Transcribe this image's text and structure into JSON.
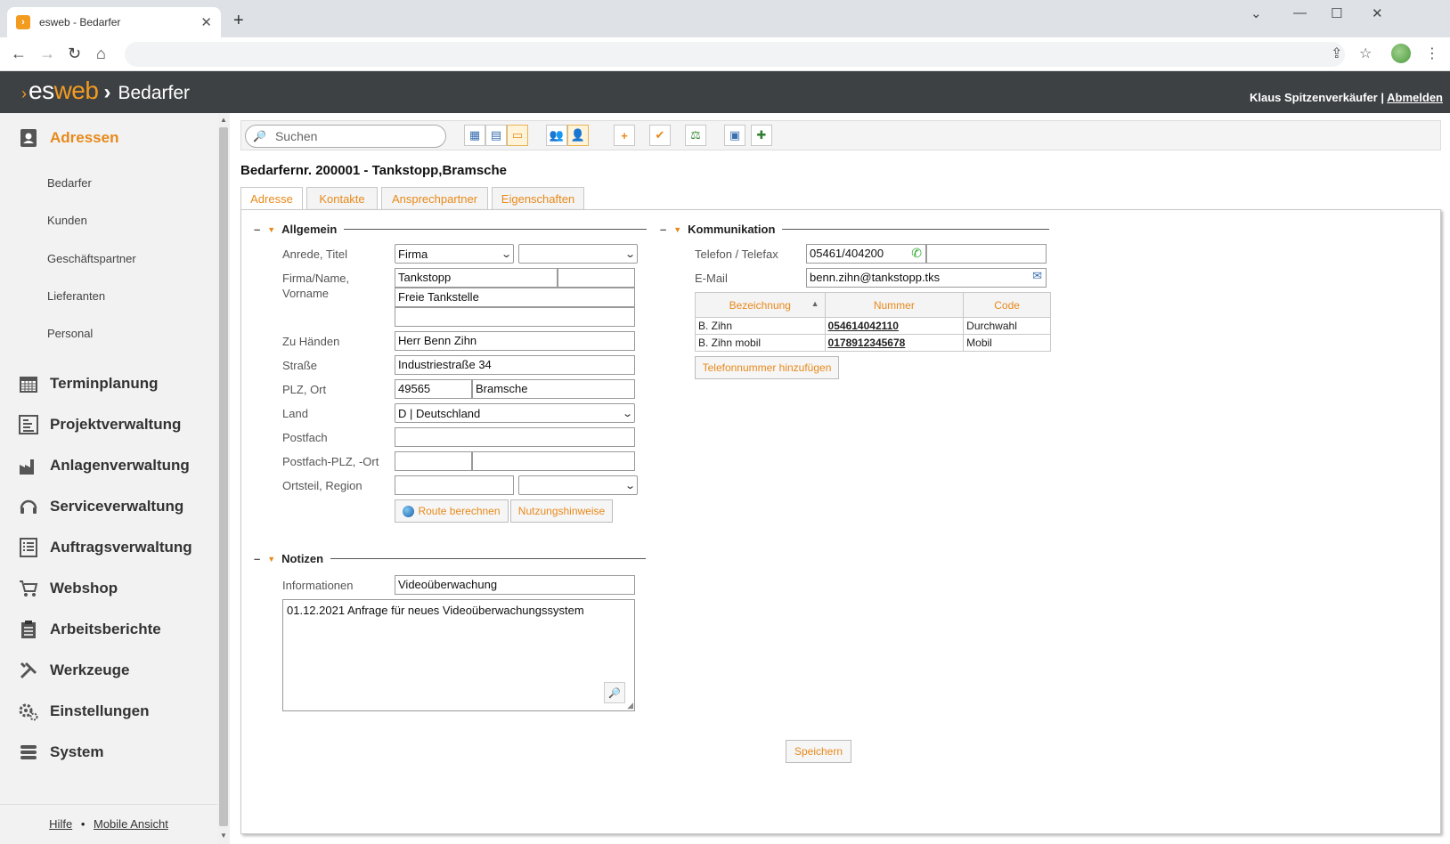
{
  "browser": {
    "tab_title": "esweb - Bedarfer",
    "tab_close": "✕",
    "new_tab": "+"
  },
  "app": {
    "logo_es": "es",
    "logo_web": "web",
    "app_name": "Bedarfer",
    "user_name": "Klaus Spitzenverkäufer",
    "separator": "|",
    "logout": "Abmelden"
  },
  "sidebar": {
    "main_items": [
      {
        "label": "Adressen",
        "icon": "address-book-icon"
      },
      {
        "label": "Terminplanung",
        "icon": "calendar-icon"
      },
      {
        "label": "Projektverwaltung",
        "icon": "project-icon"
      },
      {
        "label": "Anlagenverwaltung",
        "icon": "factory-icon"
      },
      {
        "label": "Serviceverwaltung",
        "icon": "headset-icon"
      },
      {
        "label": "Auftragsverwaltung",
        "icon": "list-icon"
      },
      {
        "label": "Webshop",
        "icon": "cart-icon"
      },
      {
        "label": "Arbeitsberichte",
        "icon": "clipboard-icon"
      },
      {
        "label": "Werkzeuge",
        "icon": "tools-icon"
      },
      {
        "label": "Einstellungen",
        "icon": "gears-icon"
      },
      {
        "label": "System",
        "icon": "database-icon"
      }
    ],
    "sub_items": [
      "Bedarfer",
      "Kunden",
      "Geschäftspartner",
      "Lieferanten",
      "Personal"
    ],
    "footer": {
      "help": "Hilfe",
      "dot": "•",
      "mobile": "Mobile Ansicht"
    }
  },
  "toolbar": {
    "search_placeholder": "Suchen"
  },
  "record": {
    "title": "Bedarfernr. 200001 - Tankstopp,Bramsche"
  },
  "tabs": [
    "Adresse",
    "Kontakte",
    "Ansprechpartner",
    "Eigenschaften"
  ],
  "allgemein": {
    "header": "Allgemein",
    "labels": {
      "anrede": "Anrede, Titel",
      "firma1": "Firma/Name,",
      "firma2": "Vorname",
      "zuhaenden": "Zu Händen",
      "strasse": "Straße",
      "plzort": "PLZ, Ort",
      "land": "Land",
      "postfach": "Postfach",
      "postfachplz": "Postfach-PLZ, -Ort",
      "ortsteil": "Ortsteil, Region"
    },
    "values": {
      "anrede": "Firma",
      "titel": "",
      "firma": "Tankstopp",
      "firma_extra": "",
      "name2": "Freie Tankstelle",
      "name3": "",
      "zuhaenden": "Herr Benn Zihn",
      "strasse": "Industriestraße 34",
      "plz": "49565",
      "ort": "Bramsche",
      "land": "D | Deutschland",
      "postfach": "",
      "postfach_plz": "",
      "postfach_ort": "",
      "ortsteil": "",
      "region": ""
    },
    "buttons": {
      "route": "Route berechnen",
      "hinweise": "Nutzungshinweise"
    }
  },
  "kommunikation": {
    "header": "Kommunikation",
    "labels": {
      "telefon": "Telefon / Telefax",
      "email": "E-Mail"
    },
    "values": {
      "telefon": "05461/404200",
      "telefax": "",
      "email": "benn.zihn@tankstopp.tks"
    },
    "table": {
      "headers": [
        "Bezeichnung",
        "Nummer",
        "Code"
      ],
      "rows": [
        [
          "B. Zihn",
          "054614042110",
          "Durchwahl"
        ],
        [
          "B. Zihn mobil",
          "0178912345678",
          "Mobil"
        ]
      ]
    },
    "add_phone": "Telefonnummer hinzufügen"
  },
  "notizen": {
    "header": "Notizen",
    "label": "Informationen",
    "info_value": "Videoüberwachung",
    "note_text": "01.12.2021 Anfrage für neues Videoüberwachungssystem"
  },
  "save_label": "Speichern",
  "colors": {
    "accent": "#e8891a",
    "header_bg": "#3d4144"
  }
}
